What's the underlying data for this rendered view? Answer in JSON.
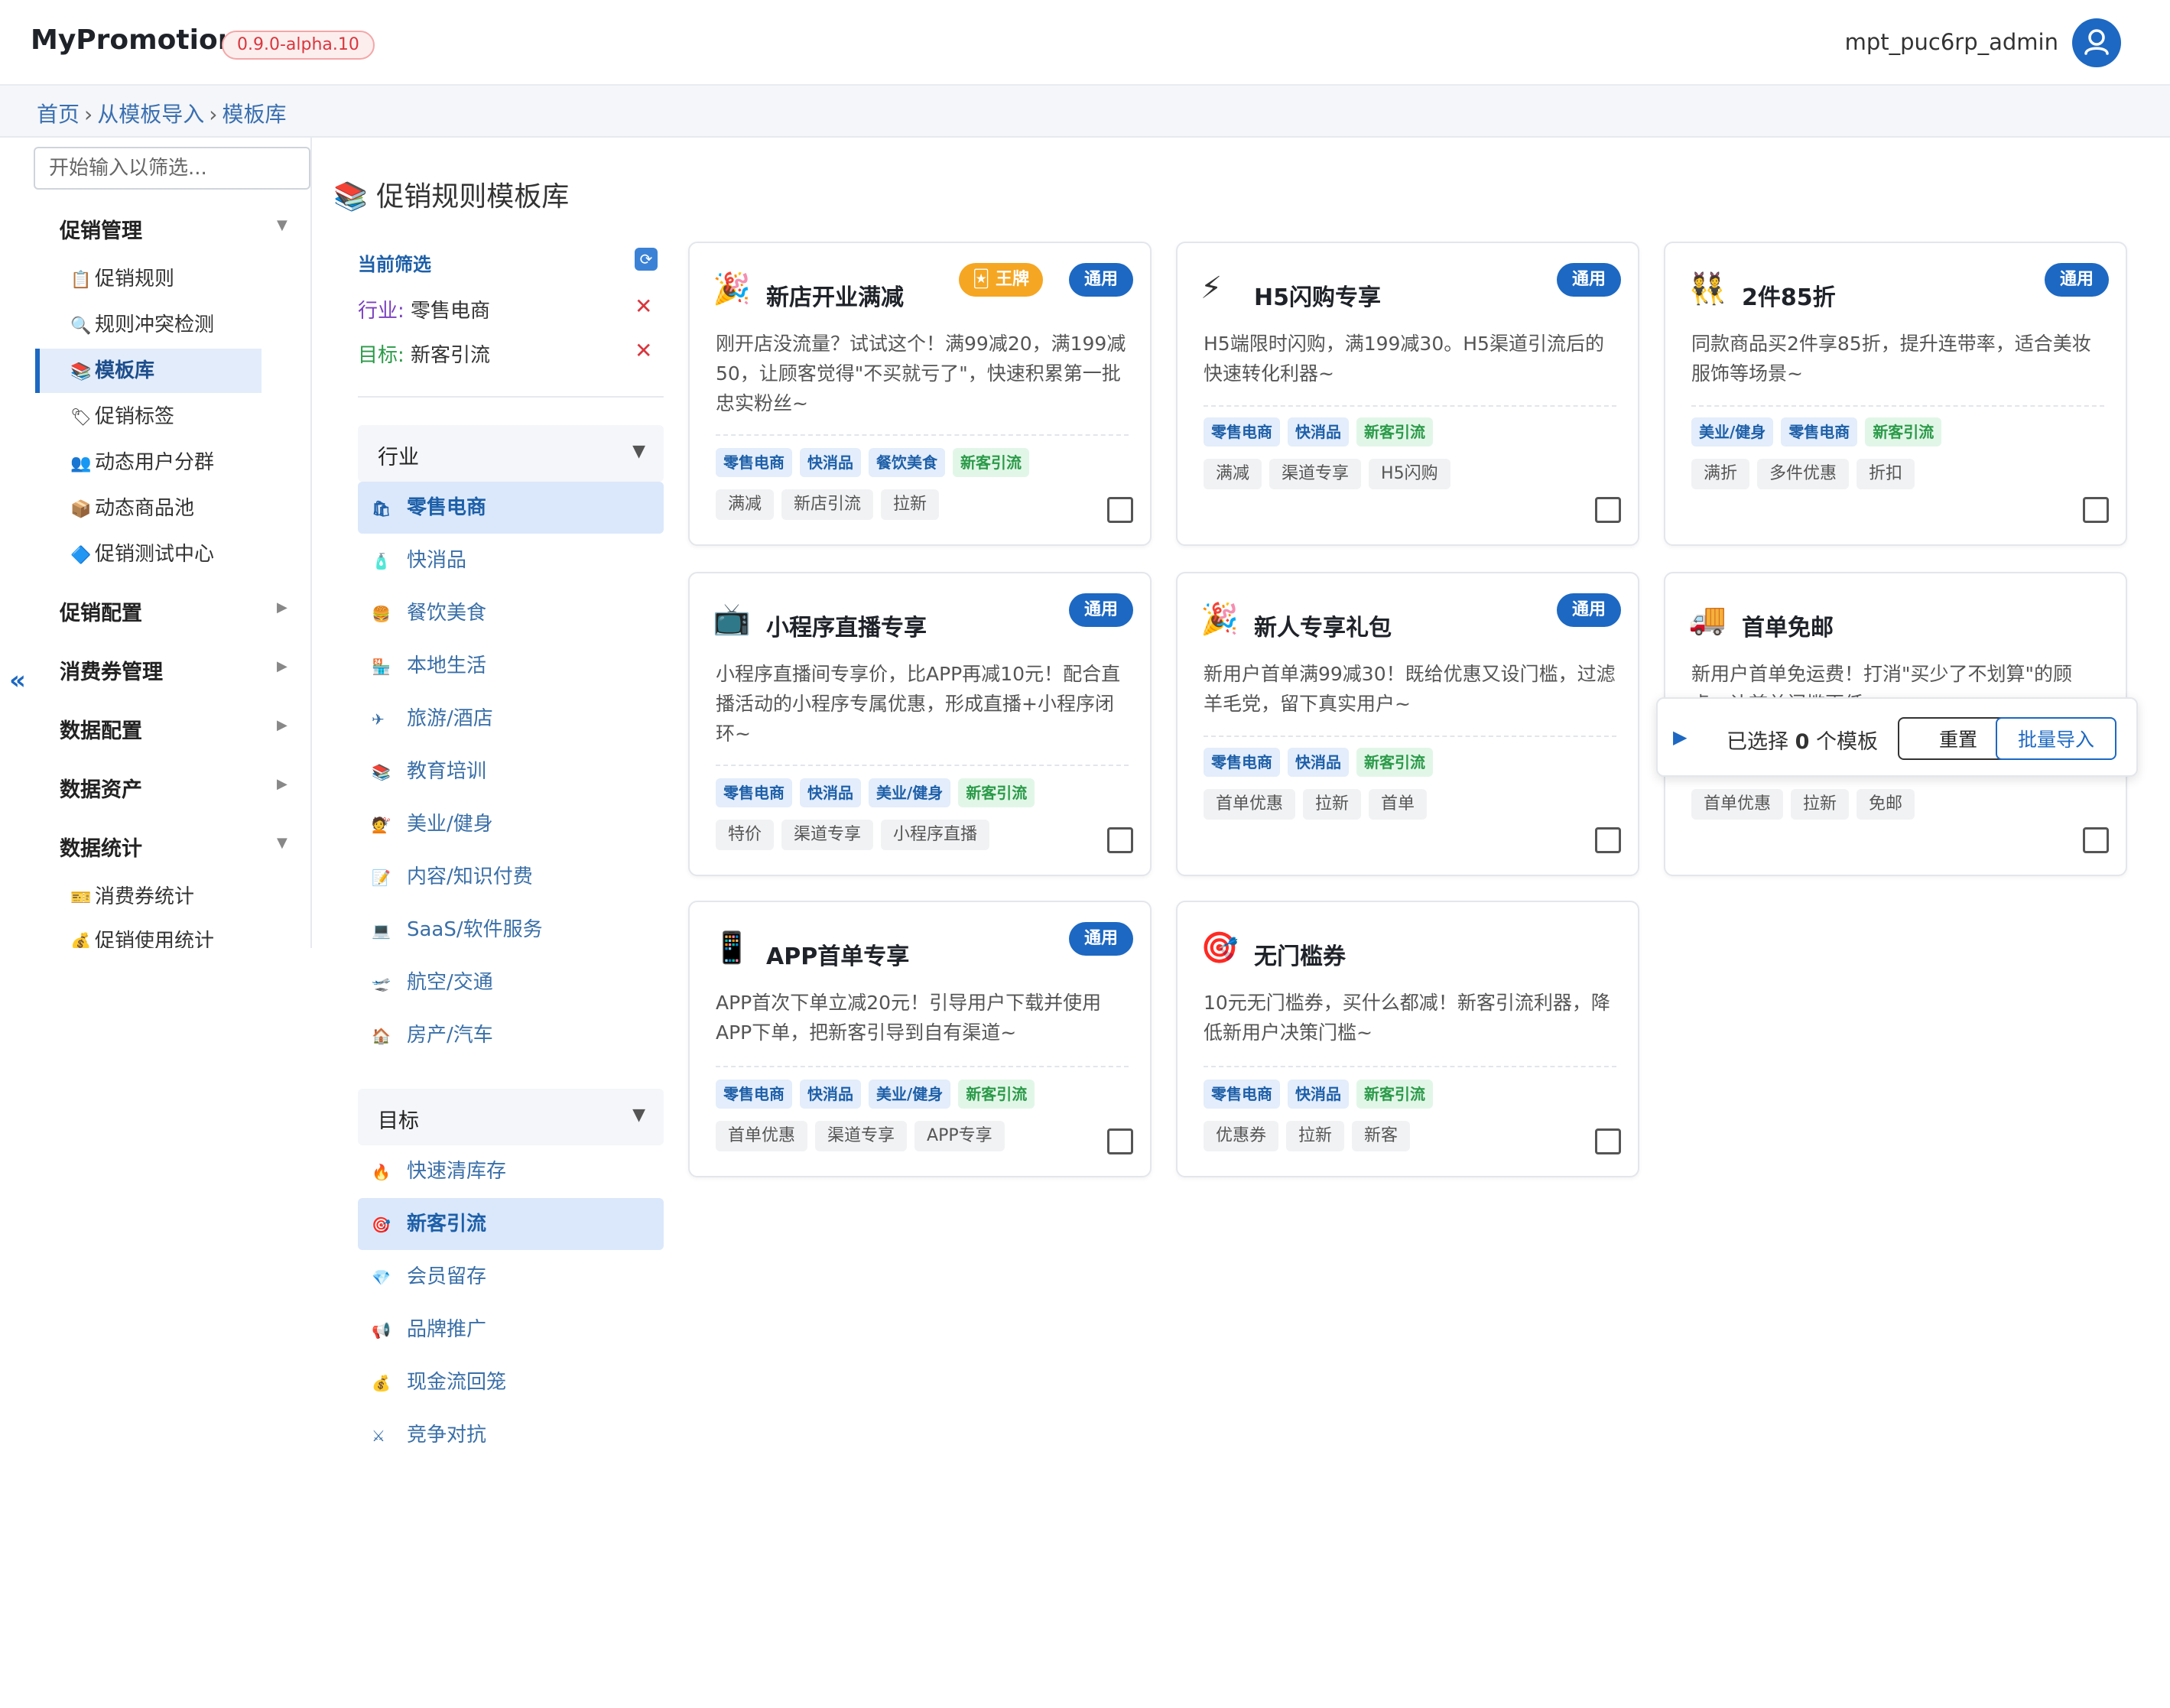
{
  "header": {
    "app_title": "MyPromotion",
    "version": "0.9.0-alpha.10",
    "username": "mpt_puc6rp_admin",
    "avatar_icon": "user-icon"
  },
  "breadcrumb": [
    "首页",
    "从模板导入",
    "模板库"
  ],
  "sidebar": {
    "search_placeholder": "开始输入以筛选...",
    "groups": [
      {
        "label": "促销管理",
        "expanded": true,
        "items": [
          {
            "icon": "📋",
            "label": "促销规则"
          },
          {
            "icon": "🔍",
            "label": "规则冲突检测"
          },
          {
            "icon": "📚",
            "label": "模板库",
            "active": true
          },
          {
            "icon": "🏷",
            "label": "促销标签"
          },
          {
            "icon": "👥",
            "label": "动态用户分群"
          },
          {
            "icon": "📦",
            "label": "动态商品池"
          },
          {
            "icon": "🔷",
            "label": "促销测试中心"
          }
        ]
      },
      {
        "label": "促销配置",
        "expanded": false
      },
      {
        "label": "消费券管理",
        "expanded": false
      },
      {
        "label": "数据配置",
        "expanded": false
      },
      {
        "label": "数据资产",
        "expanded": false
      },
      {
        "label": "数据统计",
        "expanded": true,
        "items": [
          {
            "icon": "🎫",
            "label": "消费券统计"
          },
          {
            "icon": "💰",
            "label": "促销使用统计"
          }
        ]
      }
    ],
    "collapse_symbol": "«"
  },
  "page_title": "📚 促销规则模板库",
  "filter": {
    "current_label": "当前筛选",
    "refresh_icon": "refresh-icon",
    "selected": [
      {
        "key": "行业:",
        "value": "零售电商"
      },
      {
        "key": "目标:",
        "value": "新客引流"
      }
    ],
    "industry": {
      "title": "行业",
      "options": [
        {
          "icon": "🛍",
          "label": "零售电商",
          "active": true
        },
        {
          "icon": "🧴",
          "label": "快消品"
        },
        {
          "icon": "🍔",
          "label": "餐饮美食"
        },
        {
          "icon": "🏪",
          "label": "本地生活"
        },
        {
          "icon": "✈",
          "label": "旅游/酒店"
        },
        {
          "icon": "📚",
          "label": "教育培训"
        },
        {
          "icon": "💇",
          "label": "美业/健身"
        },
        {
          "icon": "📝",
          "label": "内容/知识付费"
        },
        {
          "icon": "💻",
          "label": "SaaS/软件服务"
        },
        {
          "icon": "🛫",
          "label": "航空/交通"
        },
        {
          "icon": "🏠",
          "label": "房产/汽车"
        }
      ]
    },
    "goal": {
      "title": "目标",
      "options": [
        {
          "icon": "🔥",
          "label": "快速清库存"
        },
        {
          "icon": "🎯",
          "label": "新客引流",
          "active": true
        },
        {
          "icon": "💎",
          "label": "会员留存"
        },
        {
          "icon": "📢",
          "label": "品牌推广"
        },
        {
          "icon": "💰",
          "label": "现金流回笼"
        },
        {
          "icon": "⚔",
          "label": "竞争对抗"
        }
      ]
    }
  },
  "cards": [
    {
      "emoji": "🎉",
      "title": "新店开业满减",
      "badge": "通用",
      "badge2": "🃏 王牌",
      "desc": "刚开店没流量？试试这个！满99减20，满199减50，让顾客觉得\"不买就亏了\"，快速积累第一批忠实粉丝~",
      "tags": [
        {
          "t": "零售电商",
          "c": "blue"
        },
        {
          "t": "快消品",
          "c": "blue"
        },
        {
          "t": "餐饮美食",
          "c": "blue"
        },
        {
          "t": "新客引流",
          "c": "green"
        }
      ],
      "keywords": [
        "满减",
        "新店引流",
        "拉新"
      ]
    },
    {
      "emoji": "⚡",
      "title": "H5闪购专享",
      "badge": "通用",
      "desc": "H5端限时闪购，满199减30。H5渠道引流后的快速转化利器~",
      "tags": [
        {
          "t": "零售电商",
          "c": "blue"
        },
        {
          "t": "快消品",
          "c": "blue"
        },
        {
          "t": "新客引流",
          "c": "green"
        }
      ],
      "keywords": [
        "满减",
        "渠道专享",
        "H5闪购"
      ]
    },
    {
      "emoji": "👯",
      "title": "2件85折",
      "badge": "通用",
      "desc": "同款商品买2件享85折，提升连带率，适合美妆服饰等场景~",
      "tags": [
        {
          "t": "美业/健身",
          "c": "blue"
        },
        {
          "t": "零售电商",
          "c": "blue"
        },
        {
          "t": "新客引流",
          "c": "green"
        }
      ],
      "keywords": [
        "满折",
        "多件优惠",
        "折扣"
      ]
    },
    {
      "emoji": "📺",
      "title": "小程序直播专享",
      "badge": "通用",
      "desc": "小程序直播间专享价，比APP再减10元！配合直播活动的小程序专属优惠，形成直播+小程序闭环~",
      "tags": [
        {
          "t": "零售电商",
          "c": "blue"
        },
        {
          "t": "快消品",
          "c": "blue"
        },
        {
          "t": "美业/健身",
          "c": "blue"
        },
        {
          "t": "新客引流",
          "c": "green"
        }
      ],
      "keywords": [
        "特价",
        "渠道专享",
        "小程序直播"
      ]
    },
    {
      "emoji": "🎉",
      "title": "新人专享礼包",
      "badge": "通用",
      "desc": "新用户首单满99减30！既给优惠又设门槛，过滤羊毛党，留下真实用户~",
      "tags": [
        {
          "t": "零售电商",
          "c": "blue"
        },
        {
          "t": "快消品",
          "c": "blue"
        },
        {
          "t": "新客引流",
          "c": "green"
        }
      ],
      "keywords": [
        "首单优惠",
        "拉新",
        "首单"
      ]
    },
    {
      "emoji": "🚚",
      "title": "首单免邮",
      "badge": "",
      "desc": "新用户首单免运费！打消\"买少了不划算\"的顾虑，让首单门槛更低~",
      "tags": [],
      "keywords": [
        "首单优惠",
        "拉新",
        "免邮"
      ]
    },
    {
      "emoji": "📱",
      "title": "APP首单专享",
      "badge": "通用",
      "desc": "APP首次下单立减20元！引导用户下载并使用APP下单，把新客引导到自有渠道~",
      "tags": [
        {
          "t": "零售电商",
          "c": "blue"
        },
        {
          "t": "快消品",
          "c": "blue"
        },
        {
          "t": "美业/健身",
          "c": "blue"
        },
        {
          "t": "新客引流",
          "c": "green"
        }
      ],
      "keywords": [
        "首单优惠",
        "渠道专享",
        "APP专享"
      ]
    },
    {
      "emoji": "🎯",
      "title": "无门槛券",
      "badge": "",
      "desc": "10元无门槛券，买什么都减！新客引流利器，降低新用户决策门槛~",
      "tags": [
        {
          "t": "零售电商",
          "c": "blue"
        },
        {
          "t": "快消品",
          "c": "blue"
        },
        {
          "t": "新客引流",
          "c": "green"
        }
      ],
      "keywords": [
        "优惠券",
        "拉新",
        "新客"
      ]
    }
  ],
  "action_bar": {
    "play_icon": "play-icon",
    "prefix": "已选择",
    "count": "0",
    "suffix": "个模板",
    "reset_label": "重置",
    "import_label": "批量导入"
  }
}
